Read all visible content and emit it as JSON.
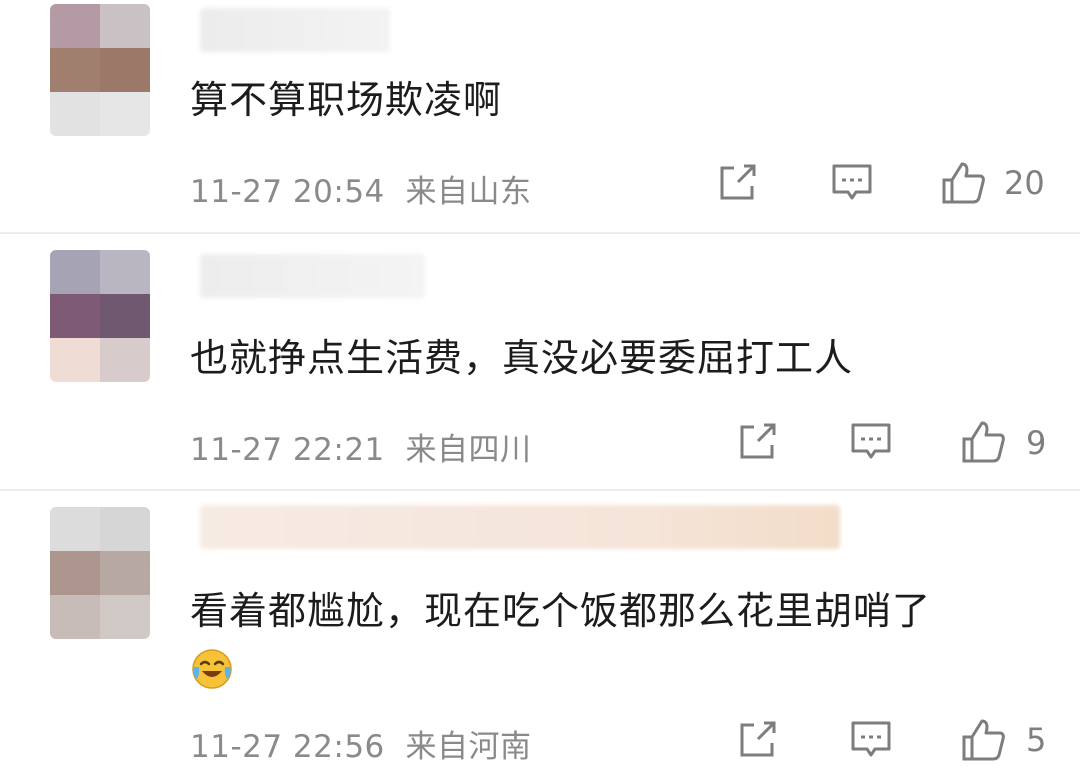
{
  "comments": [
    {
      "text": "算不算职场欺凌啊",
      "time": "11-27 20:54",
      "location": "来自山东",
      "likes": "20"
    },
    {
      "text": "也就挣点生活费，真没必要委屈打工人",
      "time": "11-27 22:21",
      "location": "来自四川",
      "likes": "9"
    },
    {
      "text": "看着都尴尬，现在吃个饭都那么花里胡哨了",
      "time": "11-27 22:56",
      "location": "来自河南",
      "likes": "5"
    }
  ],
  "icons": [
    "share-icon",
    "reply-icon",
    "like-icon",
    "laughing-crying-emoji"
  ],
  "colors": {
    "text": "#1c1c1c",
    "meta": "#8a8a8a",
    "icon": "#7d7d7d",
    "divider": "#ececec"
  }
}
